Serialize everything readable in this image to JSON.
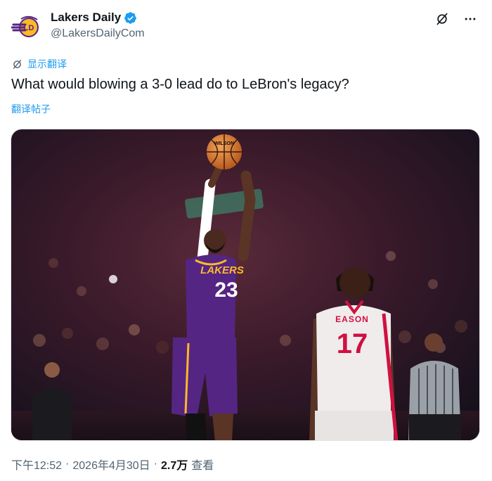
{
  "author": {
    "display_name": "Lakers Daily",
    "handle": "@LakersDailyCom",
    "avatar_icon": "lakers-daily-logo",
    "verified_icon": "verified-badge-icon",
    "verified_color": "#1d9bf0"
  },
  "header_actions": {
    "grok_icon": "grok-icon",
    "more_icon": "more-dots-icon"
  },
  "translate": {
    "show_translation_label": "显示翻译",
    "translate_post_label": "翻译帖子"
  },
  "tweet": {
    "text": "What would blowing a 3-0 lead do to LeBron's legacy?"
  },
  "media": {
    "description_icon": "basketball-photo",
    "left_jersey_team": "LAKERS",
    "left_jersey_number": "23",
    "right_jersey_name": "EASON",
    "right_jersey_number": "17",
    "ball_brand": "WILSON"
  },
  "meta": {
    "time": "下午12:52",
    "separator": "·",
    "date": "2026年4月30日",
    "views_count": "2.7万",
    "views_label": "查看"
  },
  "colors": {
    "accent": "#1d9bf0",
    "text": "#0f1419",
    "secondary": "#536471",
    "lakers_purple": "#552583",
    "lakers_gold": "#fdb927",
    "rockets_red": "#ce1141"
  }
}
